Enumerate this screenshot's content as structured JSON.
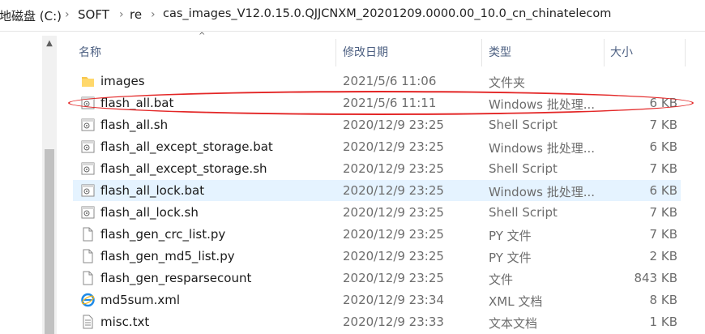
{
  "address": {
    "segments": [
      "本地磁盘 (C:)",
      "SOFT",
      "re",
      "cas_images_V12.0.15.0.QJJCNXM_20201209.0000.00_10.0_cn_chinatelecom"
    ],
    "separator": "›"
  },
  "columns": {
    "name": "名称",
    "date": "修改日期",
    "type": "类型",
    "size": "大小"
  },
  "files": [
    {
      "name": "images",
      "date": "2021/5/6 11:06",
      "type": "文件夹",
      "size": "",
      "icon": "folder-icon"
    },
    {
      "name": "flash_all.bat",
      "date": "2021/5/6 11:11",
      "type": "Windows 批处理...",
      "size": "6 KB",
      "icon": "gear-file-icon"
    },
    {
      "name": "flash_all.sh",
      "date": "2020/12/9 23:25",
      "type": "Shell Script",
      "size": "7 KB",
      "icon": "gear-file-icon"
    },
    {
      "name": "flash_all_except_storage.bat",
      "date": "2020/12/9 23:25",
      "type": "Windows 批处理...",
      "size": "6 KB",
      "icon": "gear-file-icon"
    },
    {
      "name": "flash_all_except_storage.sh",
      "date": "2020/12/9 23:25",
      "type": "Shell Script",
      "size": "7 KB",
      "icon": "gear-file-icon"
    },
    {
      "name": "flash_all_lock.bat",
      "date": "2020/12/9 23:25",
      "type": "Windows 批处理...",
      "size": "6 KB",
      "icon": "gear-file-icon"
    },
    {
      "name": "flash_all_lock.sh",
      "date": "2020/12/9 23:25",
      "type": "Shell Script",
      "size": "7 KB",
      "icon": "gear-file-icon"
    },
    {
      "name": "flash_gen_crc_list.py",
      "date": "2020/12/9 23:25",
      "type": "PY 文件",
      "size": "7 KB",
      "icon": "blank-file-icon"
    },
    {
      "name": "flash_gen_md5_list.py",
      "date": "2020/12/9 23:25",
      "type": "PY 文件",
      "size": "2 KB",
      "icon": "blank-file-icon"
    },
    {
      "name": "flash_gen_resparsecount",
      "date": "2020/12/9 23:25",
      "type": "文件",
      "size": "843 KB",
      "icon": "blank-file-icon"
    },
    {
      "name": "md5sum.xml",
      "date": "2020/12/9 23:34",
      "type": "XML 文档",
      "size": "8 KB",
      "icon": "ie-icon"
    },
    {
      "name": "misc.txt",
      "date": "2020/12/9 23:33",
      "type": "文本文档",
      "size": "1 KB",
      "icon": "text-file-icon"
    }
  ],
  "selected_file": "flash_all_lock.bat",
  "highlight": {
    "file": "flash_all.bat",
    "color": "#e32626"
  },
  "colors": {
    "selection": "#e5f3ff",
    "header_text": "#4d6082",
    "folder": "#f8c64c",
    "ie": "#1e8ae6"
  }
}
